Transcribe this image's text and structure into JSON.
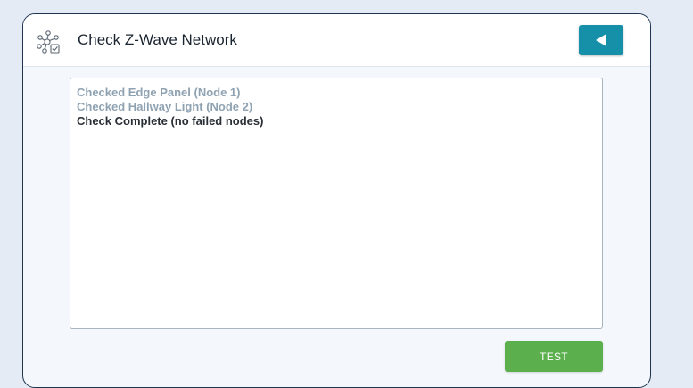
{
  "header": {
    "title": "Check Z-Wave Network",
    "icon": "network-check-icon",
    "back_button_icon": "back-arrow-icon",
    "back_button_color": "#1690a8"
  },
  "log": {
    "lines": [
      {
        "text": "Checked Edge Panel (Node 1)",
        "status": "done"
      },
      {
        "text": "Checked Hallway Light (Node 2)",
        "status": "done"
      },
      {
        "text": "Check Complete (no failed nodes)",
        "status": "current"
      }
    ]
  },
  "actions": {
    "test_label": "TEST",
    "test_color": "#5bb04d"
  }
}
